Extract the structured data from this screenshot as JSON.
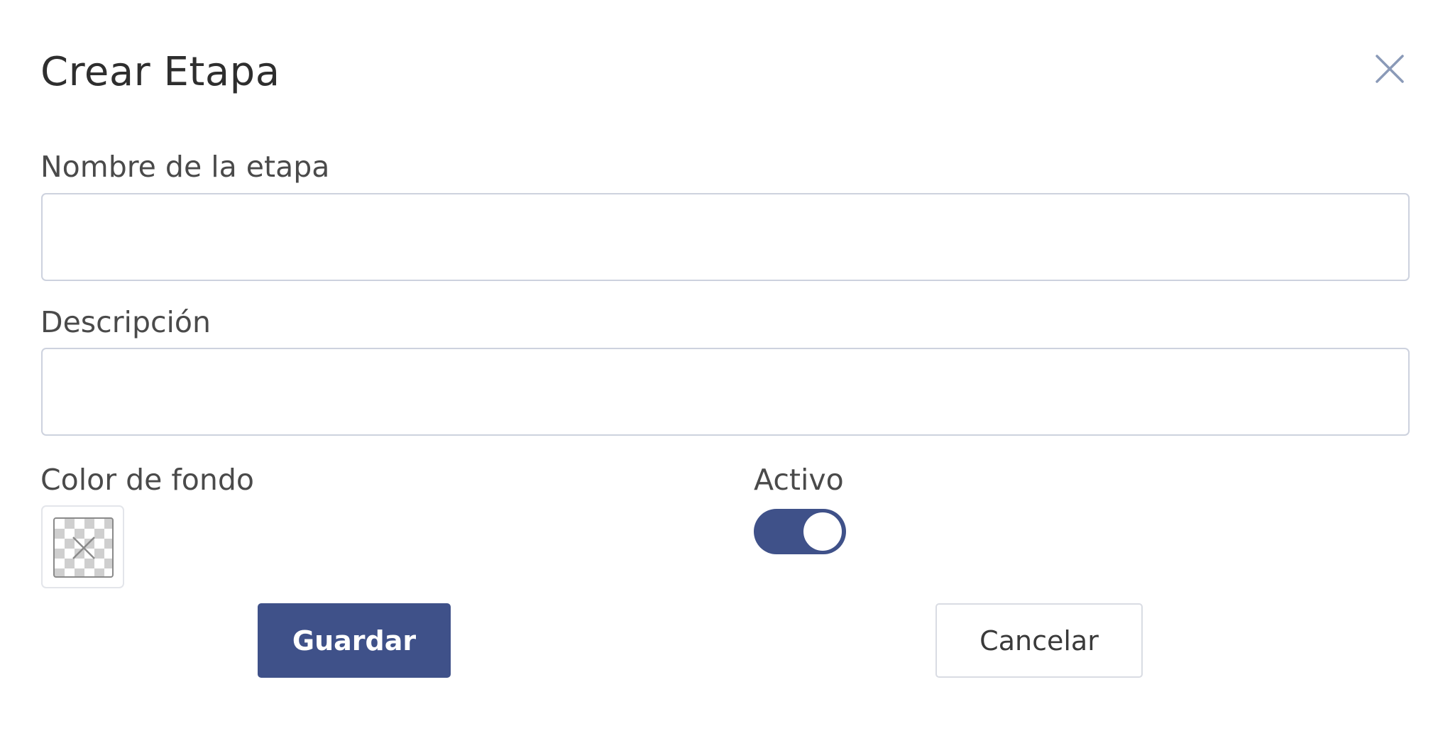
{
  "dialog": {
    "title": "Crear Etapa",
    "close_icon": "close-icon"
  },
  "form": {
    "name": {
      "label": "Nombre de la etapa",
      "value": "",
      "placeholder": ""
    },
    "description": {
      "label": "Descripción",
      "value": "",
      "placeholder": ""
    },
    "background_color": {
      "label": "Color de fondo",
      "icon": "transparent-color-swatch-icon"
    },
    "active": {
      "label": "Activo",
      "checked": true
    }
  },
  "actions": {
    "save_label": "Guardar",
    "cancel_label": "Cancelar"
  },
  "colors": {
    "primary": "#3f5189",
    "border": "#cdd2de",
    "text": "#3a3a3a",
    "close_icon": "#8a9ab8"
  }
}
